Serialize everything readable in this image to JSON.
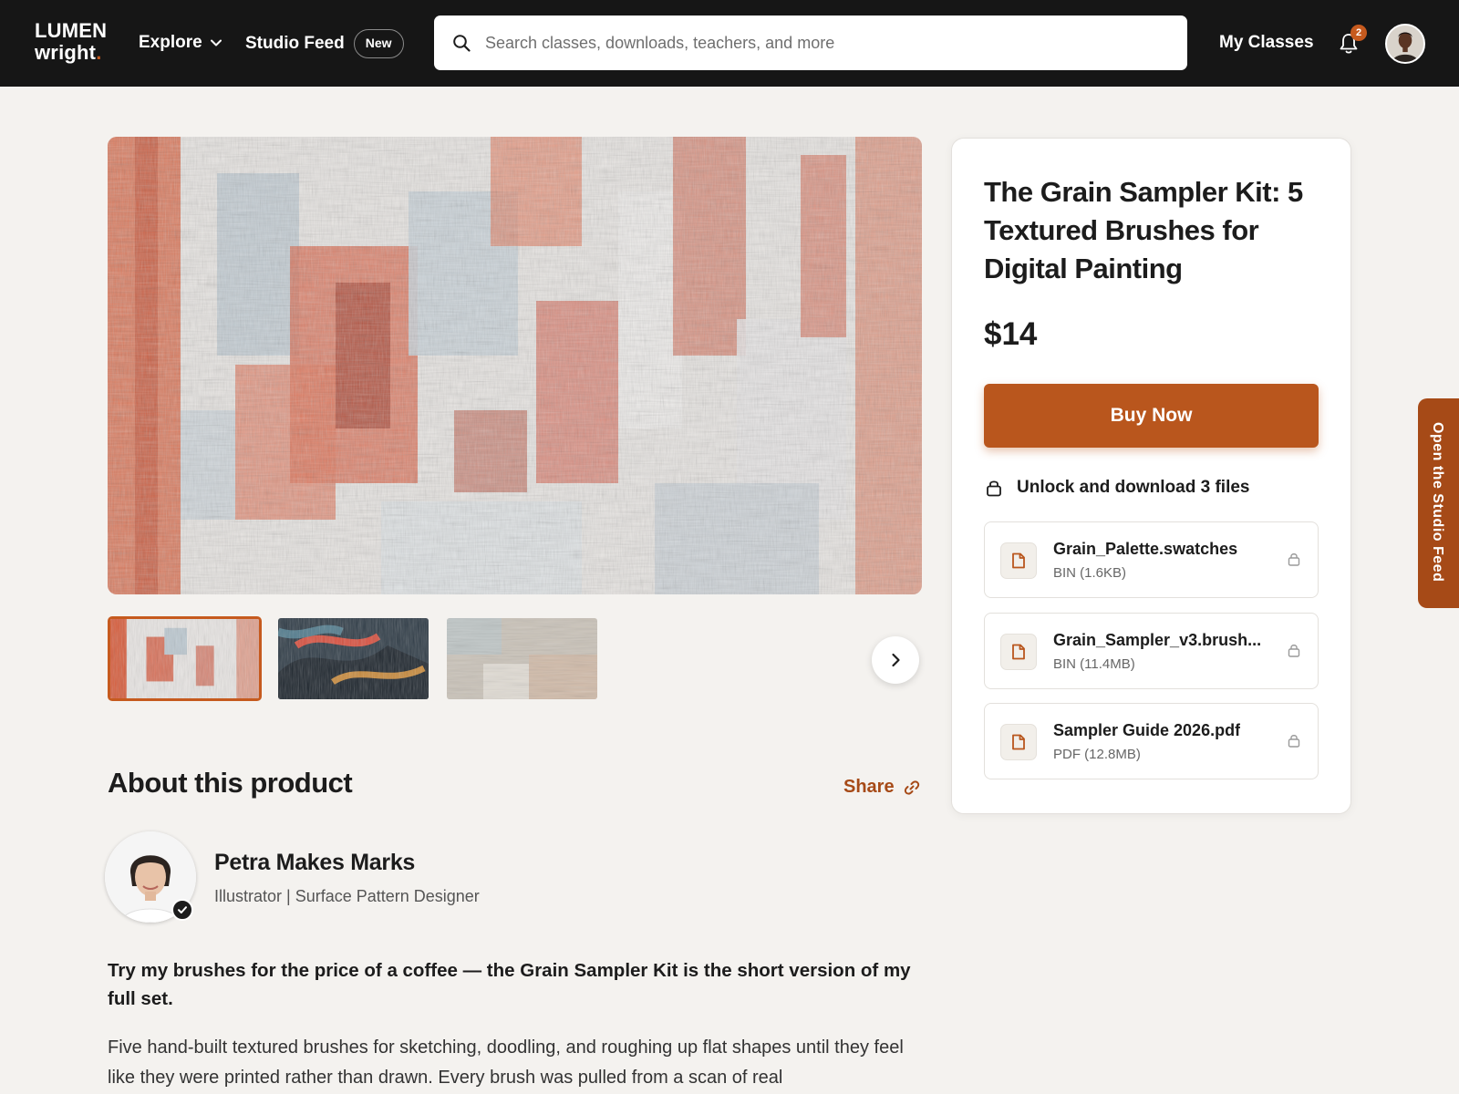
{
  "brand": {
    "line1": "LUMEN",
    "line2": "wright",
    "dot": "."
  },
  "nav": {
    "explore": "Explore",
    "studio_feed": "Studio Feed",
    "studio_feed_badge": "New",
    "my_classes": "My Classes",
    "notification_count": "2"
  },
  "search": {
    "placeholder": "Search classes, downloads, teachers, and more",
    "value": ""
  },
  "gallery": {
    "thumbnail_count": 3,
    "active_index": 0
  },
  "about": {
    "title": "About this product",
    "share": "Share",
    "creator_name": "Petra Makes Marks",
    "creator_role": "Illustrator | Surface Pattern Designer",
    "lead": "Try my brushes for the price of a coffee — the Grain Sampler Kit is the short version of my full set.",
    "body": "Five hand-built textured brushes for sketching, doodling, and roughing up flat shapes until they feel like they were printed rather than drawn. Every brush was pulled from a scan of real"
  },
  "product": {
    "title": "The Grain Sampler Kit: 5 Textured Brushes for Digital Painting",
    "price": "$14",
    "buy_label": "Buy Now",
    "unlock_text": "Unlock and download 3 files",
    "files": [
      {
        "name": "Grain_Palette.swatches",
        "meta": "BIN (1.6KB)"
      },
      {
        "name": "Grain_Sampler_v3.brush...",
        "meta": "BIN (11.4MB)"
      },
      {
        "name": "Sampler Guide 2026.pdf",
        "meta": "PDF (12.8MB)"
      }
    ]
  },
  "side_tab": "Open the Studio Feed",
  "colors": {
    "accent": "#b9561d",
    "accent_dark": "#a64a17",
    "topbar": "#161616",
    "background": "#f4f2ef"
  }
}
